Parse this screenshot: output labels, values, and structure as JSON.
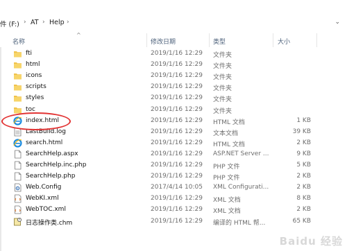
{
  "breadcrumb": {
    "drive": "件 (F:)",
    "seg1": "AT",
    "seg2": "Help"
  },
  "columns": {
    "name": "名称",
    "date": "修改日期",
    "type": "类型",
    "size": "大小"
  },
  "files": [
    {
      "name": "fti",
      "date": "2019/1/16 12:29",
      "type": "文件夹",
      "size": "",
      "icon": "folder-icon"
    },
    {
      "name": "html",
      "date": "2019/1/16 12:29",
      "type": "文件夹",
      "size": "",
      "icon": "folder-icon"
    },
    {
      "name": "icons",
      "date": "2019/1/16 12:29",
      "type": "文件夹",
      "size": "",
      "icon": "folder-icon"
    },
    {
      "name": "scripts",
      "date": "2019/1/16 12:29",
      "type": "文件夹",
      "size": "",
      "icon": "folder-icon"
    },
    {
      "name": "styles",
      "date": "2019/1/16 12:29",
      "type": "文件夹",
      "size": "",
      "icon": "folder-icon"
    },
    {
      "name": "toc",
      "date": "2019/1/16 12:29",
      "type": "文件夹",
      "size": "",
      "icon": "folder-icon"
    },
    {
      "name": "index.html",
      "date": "2019/1/16 12:29",
      "type": "HTML 文档",
      "size": "1 KB",
      "icon": "ie-html-icon"
    },
    {
      "name": "LastBuild.log",
      "date": "2019/1/16 12:29",
      "type": "文本文档",
      "size": "39 KB",
      "icon": "text-file-icon"
    },
    {
      "name": "search.html",
      "date": "2019/1/16 12:29",
      "type": "HTML 文档",
      "size": "2 KB",
      "icon": "ie-html-icon"
    },
    {
      "name": "SearchHelp.aspx",
      "date": "2019/1/16 12:29",
      "type": "ASP.NET Server ...",
      "size": "9 KB",
      "icon": "blank-file-icon"
    },
    {
      "name": "SearchHelp.inc.php",
      "date": "2019/1/16 12:29",
      "type": "PHP 文件",
      "size": "5 KB",
      "icon": "blank-file-icon"
    },
    {
      "name": "SearchHelp.php",
      "date": "2019/1/16 12:29",
      "type": "PHP 文件",
      "size": "2 KB",
      "icon": "blank-file-icon"
    },
    {
      "name": "Web.Config",
      "date": "2017/4/14 10:05",
      "type": "XML Configurati...",
      "size": "2 KB",
      "icon": "config-file-icon"
    },
    {
      "name": "WebKI.xml",
      "date": "2019/1/16 12:29",
      "type": "XML 文档",
      "size": "8 KB",
      "icon": "xml-file-icon"
    },
    {
      "name": "WebTOC.xml",
      "date": "2019/1/16 12:29",
      "type": "XML 文档",
      "size": "2 KB",
      "icon": "xml-file-icon"
    },
    {
      "name": "日志操作类.chm",
      "date": "2019/1/16 12:29",
      "type": "编译的 HTML 帮...",
      "size": "65 KB",
      "icon": "chm-file-icon"
    }
  ],
  "watermark": "Baidu 经验"
}
